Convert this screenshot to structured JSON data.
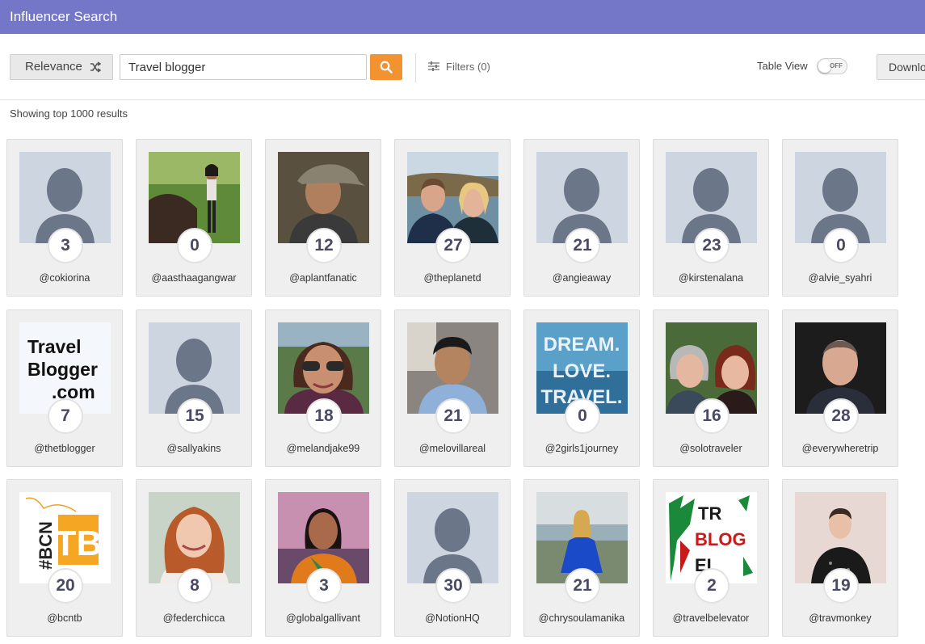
{
  "app": {
    "title": "Influencer Search"
  },
  "toolbar": {
    "sort_label": "Relevance",
    "search_value": "Travel blogger",
    "filters_label": "Filters (0)",
    "table_view_label": "Table View",
    "toggle_state": "OFF",
    "download_label": "Downlo"
  },
  "results_text": "Showing top 1000 results",
  "influencers": [
    {
      "handle": "@cokiorina",
      "score": "3",
      "photo": "placeholder"
    },
    {
      "handle": "@aasthaagangwar",
      "score": "0",
      "photo": "nature"
    },
    {
      "handle": "@aplantfanatic",
      "score": "12",
      "photo": "man-cap"
    },
    {
      "handle": "@theplanetd",
      "score": "27",
      "photo": "couple"
    },
    {
      "handle": "@angieaway",
      "score": "21",
      "photo": "placeholder"
    },
    {
      "handle": "@kirstenalana",
      "score": "23",
      "photo": "placeholder"
    },
    {
      "handle": "@alvie_syahri",
      "score": "0",
      "photo": "placeholder"
    },
    {
      "handle": "@thetblogger",
      "score": "7",
      "photo": "travelblogger-logo",
      "logo_text": [
        "Travel",
        "Blogger",
        ".com"
      ]
    },
    {
      "handle": "@sallyakins",
      "score": "15",
      "photo": "placeholder"
    },
    {
      "handle": "@melandjake99",
      "score": "18",
      "photo": "woman-sunglasses"
    },
    {
      "handle": "@melovillareal",
      "score": "21",
      "photo": "man-car"
    },
    {
      "handle": "@2girls1journey",
      "score": "0",
      "photo": "dream-love-travel",
      "logo_text": [
        "DREAM.",
        "LOVE.",
        "TRAVEL."
      ]
    },
    {
      "handle": "@solotraveler",
      "score": "16",
      "photo": "two-women"
    },
    {
      "handle": "@everywheretrip",
      "score": "28",
      "photo": "man-dark"
    },
    {
      "handle": "@bcntb",
      "score": "20",
      "photo": "bcntb-logo",
      "logo_text": [
        "#BCN",
        "TB"
      ]
    },
    {
      "handle": "@federchicca",
      "score": "8",
      "photo": "woman-red-hair"
    },
    {
      "handle": "@globalgallivant",
      "score": "3",
      "photo": "woman-sari"
    },
    {
      "handle": "@NotionHQ",
      "score": "30",
      "photo": "placeholder"
    },
    {
      "handle": "@chrysoulamanika",
      "score": "21",
      "photo": "woman-blue-dress"
    },
    {
      "handle": "@travelbelevator",
      "score": "2",
      "photo": "travel-blog-logo",
      "logo_text": [
        "TR",
        "BLOG",
        "EL"
      ]
    },
    {
      "handle": "@travmonkey",
      "score": "19",
      "photo": "man-tshirt"
    }
  ]
}
